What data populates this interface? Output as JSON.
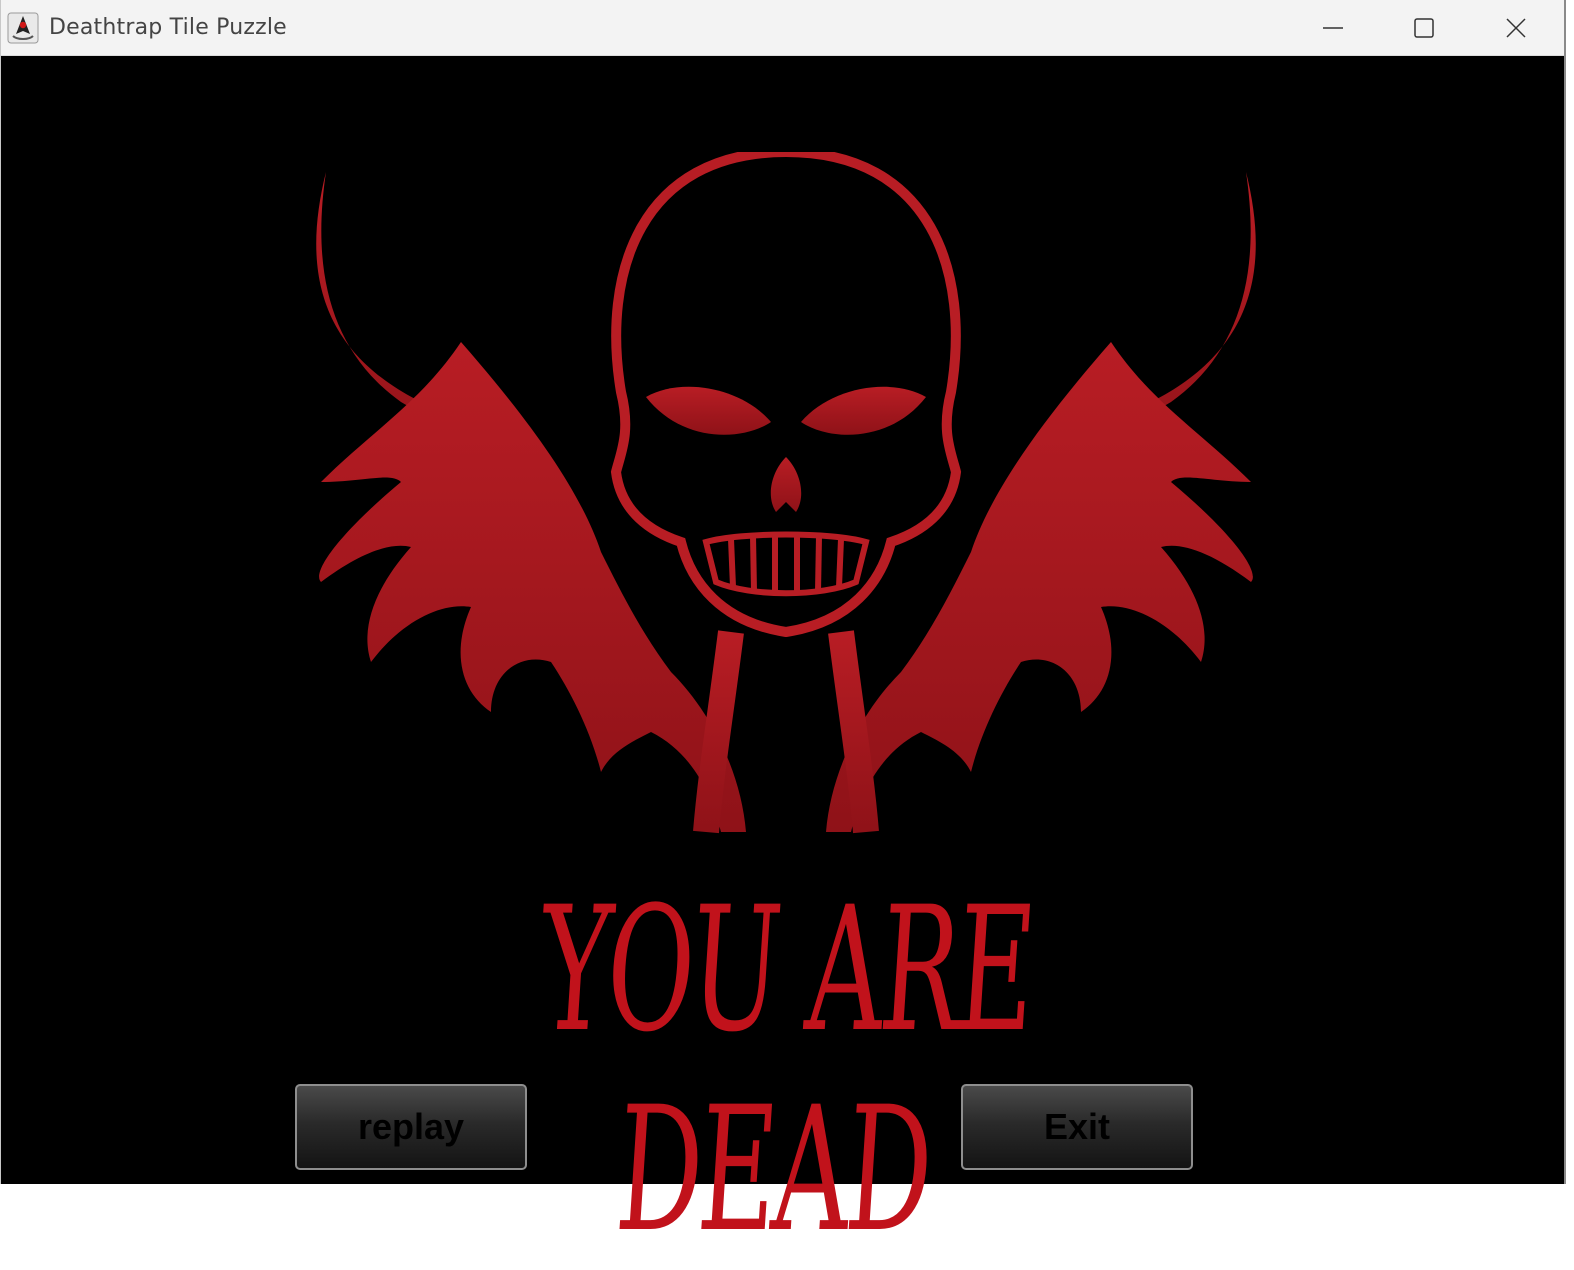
{
  "window": {
    "title": "Deathtrap Tile Puzzle",
    "app_icon": "java-duke-icon",
    "controls": {
      "minimize_icon": "minimize-icon",
      "maximize_icon": "maximize-icon",
      "close_icon": "close-icon"
    }
  },
  "screen": {
    "headline": "YOU ARE DEAD",
    "artwork": "winged-skull-illustration",
    "accent_color": "#c1121b",
    "background_color": "#000000"
  },
  "buttons": {
    "replay_label": "replay",
    "exit_label": "Exit"
  }
}
